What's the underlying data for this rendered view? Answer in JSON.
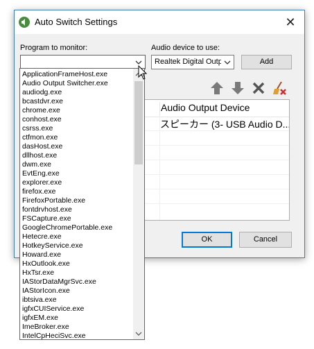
{
  "window": {
    "title": "Auto Switch Settings",
    "close_glyph": "✕"
  },
  "labels": {
    "program": "Program to monitor:",
    "audio_device": "Audio device to use:"
  },
  "program_combo": {
    "value": ""
  },
  "audio_combo": {
    "value": "Realtek Digital Output"
  },
  "buttons": {
    "add": "Add",
    "ok": "OK",
    "cancel": "Cancel"
  },
  "toolbar_icons": [
    "move-up-icon",
    "move-down-icon",
    "delete-icon",
    "clear-all-icon"
  ],
  "list": {
    "column_header": "Audio Output Device",
    "rows": [
      "スピーカー (3- USB Audio D..."
    ]
  },
  "dropdown": {
    "items": [
      "ApplicationFrameHost.exe",
      "Audio Output Switcher.exe",
      "audiodg.exe",
      "bcastdvr.exe",
      "chrome.exe",
      "conhost.exe",
      "csrss.exe",
      "ctfmon.exe",
      "dasHost.exe",
      "dllhost.exe",
      "dwm.exe",
      "EvtEng.exe",
      "explorer.exe",
      "firefox.exe",
      "FirefoxPortable.exe",
      "fontdrvhost.exe",
      "FSCapture.exe",
      "GoogleChromePortable.exe",
      "Hetecre.exe",
      "HotkeyService.exe",
      "Howard.exe",
      "HxOutlook.exe",
      "HxTsr.exe",
      "IAStorDataMgrSvc.exe",
      "IAStorIcon.exe",
      "ibtsiva.exe",
      "igfxCUIService.exe",
      "igfxEM.exe",
      "ImeBroker.exe",
      "IntelCpHeciSvc.exe"
    ]
  },
  "colors": {
    "accent": "#0078d7",
    "window_border": "#3c7fb1",
    "toolbar_arrow": "#7a7a7a",
    "delete_red": "#d9262c"
  }
}
